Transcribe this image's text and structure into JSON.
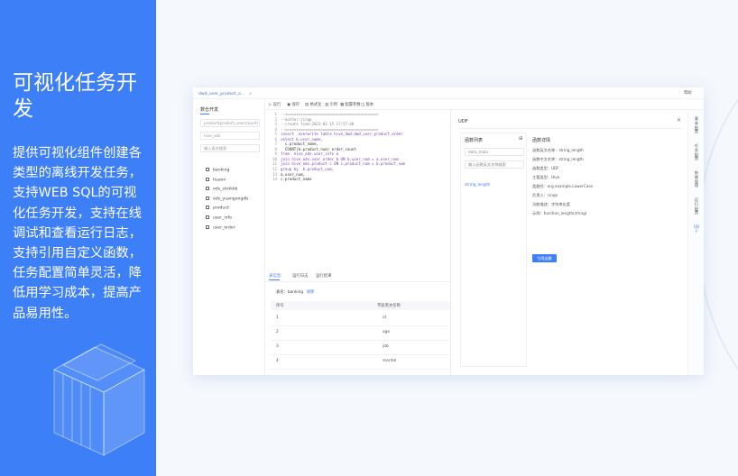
{
  "hero": {
    "title": "可视化任务开发",
    "description": "提供可视化组件创建各类型的离线开发任务，支持WEB SQL的可视化任务开发，支持在线调试和查看运行日志，支持引用自定义函数，任务配置简单灵活，降低用学习成本，提高产品易用性。"
  },
  "window": {
    "tab_label": "dwd_user_product_o...",
    "tab_close": "×",
    "help_label": "帮助"
  },
  "sidebar": {
    "title": "数仓开发",
    "task_select": "product(product_user/count)",
    "db_select": "hive_ods",
    "search_placeholder": "输入表名搜索",
    "tables": [
      "banking",
      "huaxn",
      "ods_strokkb",
      "ods_yuangongdb",
      "product",
      "user_info",
      "user_order"
    ]
  },
  "toolbar": {
    "buttons": [
      "运行",
      "保存",
      "格式化",
      "引用",
      "配置参数",
      "版本"
    ]
  },
  "editor": {
    "lines": [
      "--==========================================",
      "--author:jinqp",
      "--create time:2023-02-15 17:57:40",
      "--==========================================",
      "insert  overwrite table hive_dwd.dwd_user_product_order",
      "select b.user_name,",
      "  c.product_name,",
      "  COUNT(b.product_num) order_count",
      "from  hive_ods.user_info a",
      "join hive_ods.user_order b ON b.user_num = a.user_num",
      "join hive_ods.product c ON c.product_num = b.product_num",
      "group by  b.product_num,",
      "a.user_num,",
      "c.product_name"
    ]
  },
  "results": {
    "tabs": [
      "表信息",
      "运行日志",
      "运行结果"
    ],
    "table_label": "表名：banking",
    "refresh_label": "刷新",
    "headers": [
      "序号",
      "字段英文名称"
    ],
    "rows": [
      [
        "1",
        "id"
      ],
      [
        "2",
        "age"
      ],
      [
        "3",
        "job"
      ],
      [
        "4",
        "marital"
      ]
    ]
  },
  "udf": {
    "title": "UDF",
    "close": "×",
    "list_title": "函数列表",
    "add_icon": "⊞",
    "db_select": "data_mala",
    "search_placeholder": "输入函数英文名称搜索",
    "functions": [
      "string_length"
    ],
    "detail_title": "函数详情",
    "details": [
      "函数英文名称：string_length",
      "函数中文名称：string_length",
      "函数类型：UDF",
      "主要类型：Hive",
      "类路径：org.example.LowerCase",
      "负责人：cinqe",
      "功能描述：字符串长度",
      "示例：function_length(string)"
    ],
    "apply_label": "引用函数"
  },
  "side_tabs": [
    "基本配置",
    "任务配置",
    "依赖管理",
    "运行配置",
    "UDF"
  ]
}
